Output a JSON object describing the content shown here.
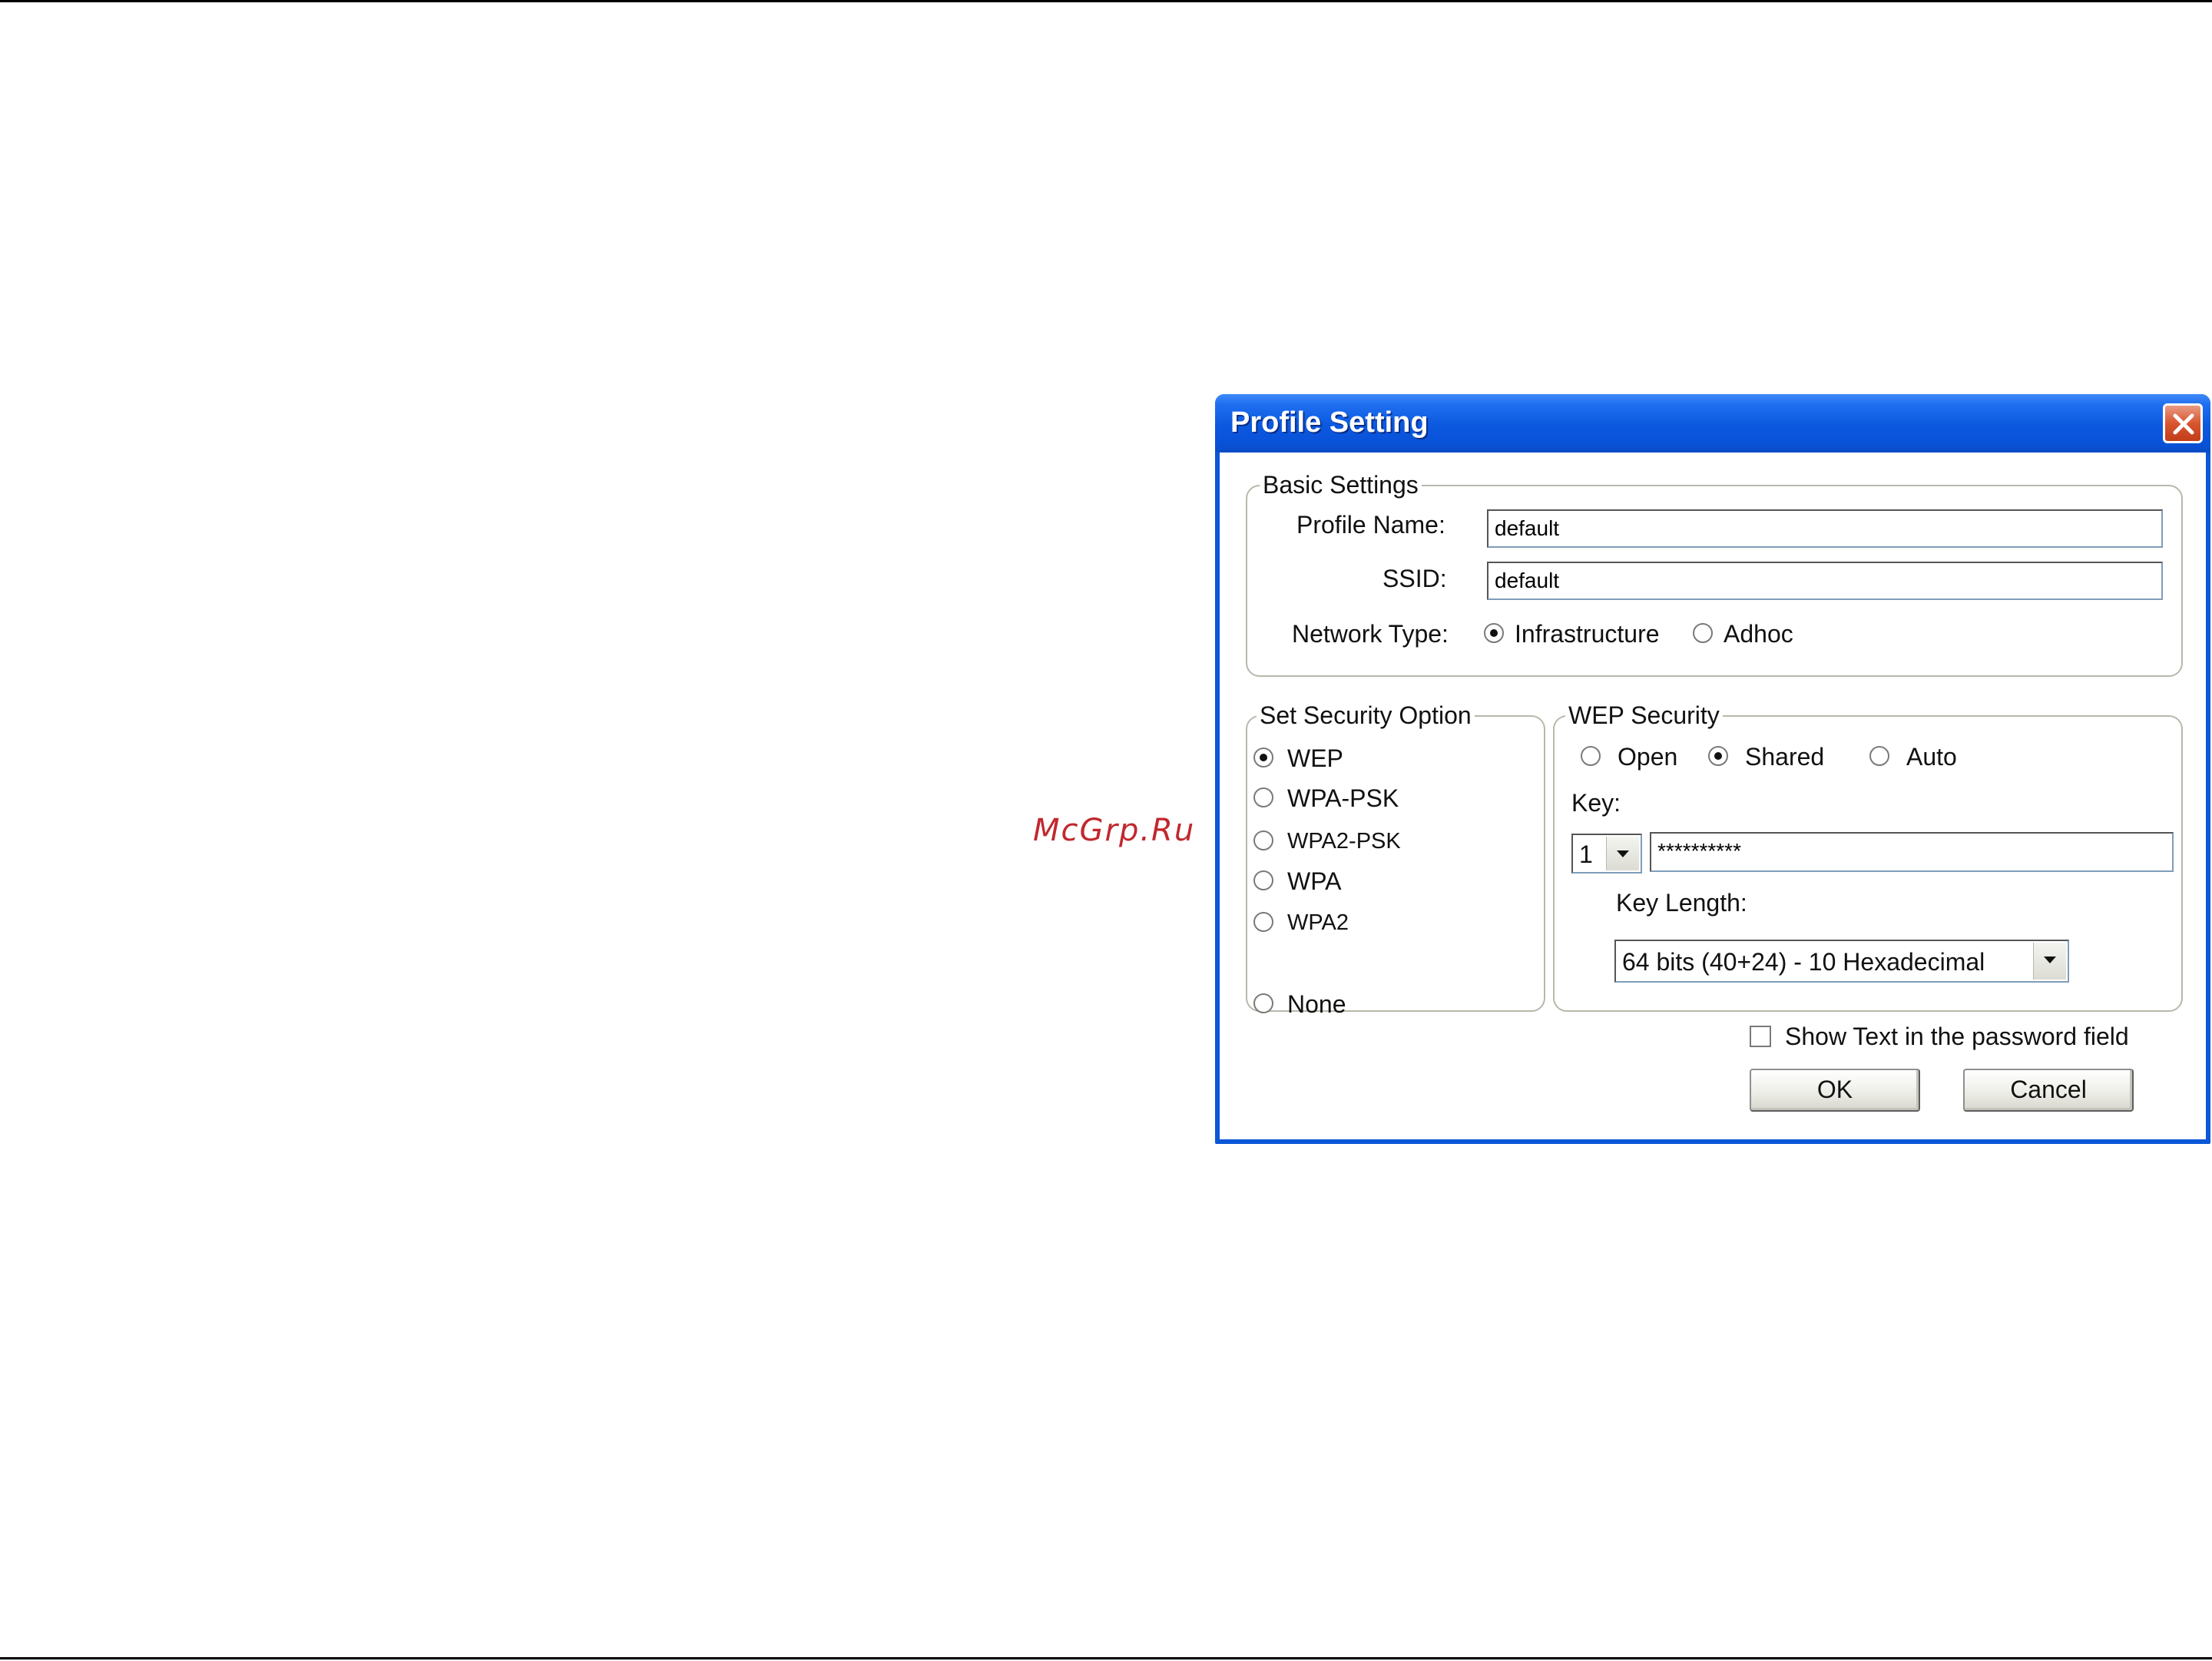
{
  "watermark": "McGrp.Ru",
  "dialog": {
    "title": "Profile Setting",
    "basic_settings": {
      "legend": "Basic Settings",
      "profile_name_label": "Profile Name:",
      "profile_name_value": "default",
      "ssid_label": "SSID:",
      "ssid_value": "default",
      "network_type_label": "Network Type:",
      "network_types": [
        "Infrastructure",
        "Adhoc"
      ],
      "network_type_selected": "Infrastructure"
    },
    "security_option": {
      "legend": "Set Security Option",
      "options": [
        "WEP",
        "WPA-PSK",
        "WPA2-PSK",
        "WPA",
        "WPA2",
        "None"
      ],
      "selected": "WEP"
    },
    "wep_security": {
      "legend": "WEP Security",
      "auth_modes": [
        "Open",
        "Shared",
        "Auto"
      ],
      "auth_selected": "Shared",
      "key_label": "Key:",
      "key_index": "1",
      "key_value": "**********",
      "key_length_label": "Key Length:",
      "key_length_value": "64 bits (40+24) - 10 Hexadecimal"
    },
    "show_text_label": "Show Text in the password field",
    "show_text_checked": false,
    "ok_label": "OK",
    "cancel_label": "Cancel"
  }
}
